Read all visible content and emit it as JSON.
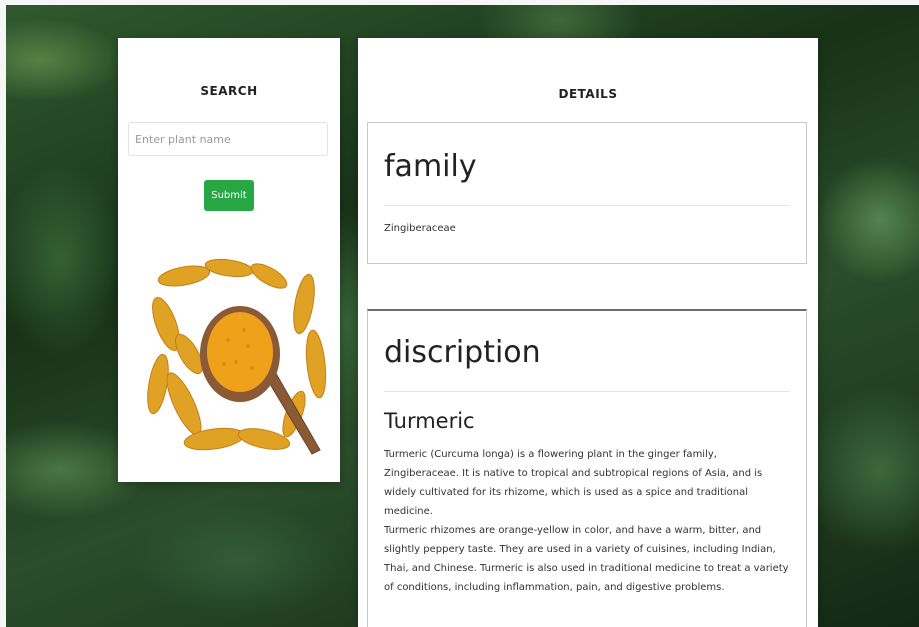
{
  "search": {
    "title": "SEARCH",
    "input_placeholder": "Enter plant name",
    "input_value": "",
    "submit_label": "Submit",
    "image_alt": "turmeric-photo"
  },
  "details": {
    "title": "DETAILS",
    "family": {
      "heading": "family",
      "value": "Zingiberaceae"
    },
    "description": {
      "heading": "discription",
      "subtitle": "Turmeric",
      "paragraph_1": "Turmeric (Curcuma longa) is a flowering plant in the ginger family, Zingiberaceae. It is native to tropical and subtropical regions of Asia, and is widely cultivated for its rhizome, which is used as a spice and traditional medicine.",
      "paragraph_2": "Turmeric rhizomes are orange-yellow in color, and have a warm, bitter, and slightly peppery taste. They are used in a variety of cuisines, including Indian, Thai, and Chinese. Turmeric is also used in traditional medicine to treat a variety of conditions, including inflammation, pain, and digestive problems."
    }
  },
  "colors": {
    "submit_button": "#28a745",
    "card_background": "#ffffff"
  }
}
